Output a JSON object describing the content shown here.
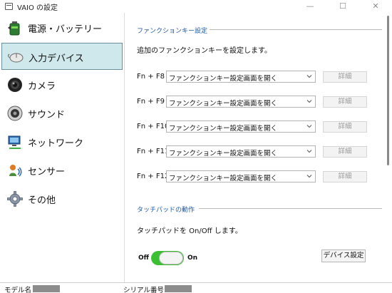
{
  "window": {
    "title": "VAIO の設定",
    "minimize_glyph": "—",
    "maximize_glyph": "☐",
    "close_glyph": "✕"
  },
  "sidebar": {
    "items": [
      {
        "label": "電源・バッテリー",
        "icon": "battery-icon",
        "selected": false
      },
      {
        "label": "入力デバイス",
        "icon": "mouse-icon",
        "selected": true
      },
      {
        "label": "カメラ",
        "icon": "camera-icon",
        "selected": false
      },
      {
        "label": "サウンド",
        "icon": "speaker-icon",
        "selected": false
      },
      {
        "label": "ネットワーク",
        "icon": "network-icon",
        "selected": false
      },
      {
        "label": "センサー",
        "icon": "sensor-icon",
        "selected": false
      },
      {
        "label": "その他",
        "icon": "gear-icon",
        "selected": false
      }
    ]
  },
  "function_keys": {
    "heading": "ファンクションキー設定",
    "description": "追加のファンクションキーを設定します。",
    "rows": [
      {
        "key": "Fn + F8",
        "value": "ファンクションキー設定画面を開く",
        "detail_label": "詳細"
      },
      {
        "key": "Fn + F9",
        "value": "ファンクションキー設定画面を開く",
        "detail_label": "詳細"
      },
      {
        "key": "Fn + F10",
        "value": "ファンクションキー設定画面を開く",
        "detail_label": "詳細"
      },
      {
        "key": "Fn + F11",
        "value": "ファンクションキー設定画面を開く",
        "detail_label": "詳細"
      },
      {
        "key": "Fn + F12",
        "value": "ファンクションキー設定画面を開く",
        "detail_label": "詳細"
      }
    ]
  },
  "touchpad": {
    "heading": "タッチパッドの動作",
    "description": "タッチパッドを On/Off します。",
    "off_label": "Off",
    "on_label": "On",
    "toggle_state": "on",
    "device_settings_label": "デバイス設定"
  },
  "statusbar": {
    "model_label": "モデル名",
    "serial_label": "シリアル番号"
  },
  "colors": {
    "accent_heading": "#1f5aa8",
    "toggle_on": "#3cc033",
    "selected_bg": "#cfe8ec"
  }
}
